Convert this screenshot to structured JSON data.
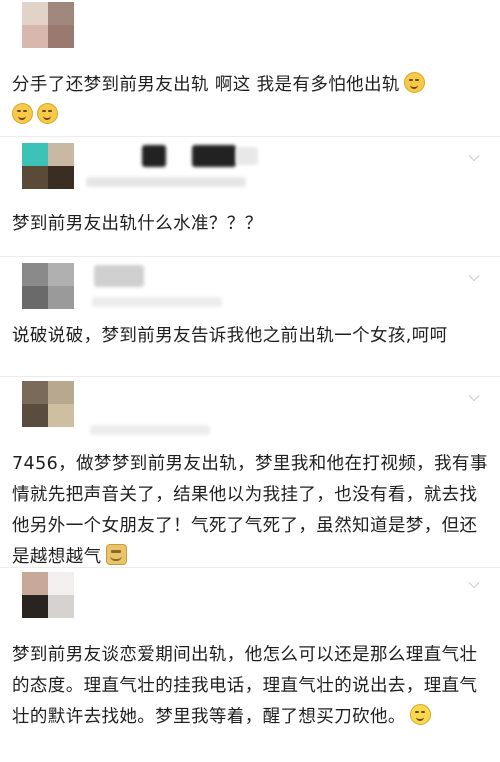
{
  "comments": [
    {
      "text": "分手了还梦到前男友出轨 啊这 我是有多怕他出轨",
      "emoji_names": [
        "facepalm-emoji",
        "facepalm-emoji",
        "facepalm-emoji"
      ],
      "avatar_colors": [
        "#e2d3c9",
        "#a0877d",
        "#d8b8ae",
        "#9a7a70"
      ]
    },
    {
      "text": "梦到前男友出轨什么水准？？？",
      "avatar_colors": [
        "#3cc2b6",
        "#c9b8a3",
        "#5a4a38",
        "#3a2e22"
      ]
    },
    {
      "text": "说破说破，梦到前男友告诉我他之前出轨一个女孩,呵呵",
      "avatar_colors": [
        "#8a8a8a",
        "#b0b0b0",
        "#6a6a6a",
        "#9a9a9a"
      ]
    },
    {
      "text": "7456，做梦梦到前男友出轨，梦里我和他在打视频，我有事情就先把声音关了，结果他以为我挂了，也没有看，就去找他另外一个女朋友了！气死了气死了，虽然知道是梦，但还是越想越气",
      "emoji_names": [
        "fist-emoji"
      ],
      "avatar_colors": [
        "#7a6a5a",
        "#b8a88f",
        "#5a4d40",
        "#cdbf9f"
      ]
    },
    {
      "text": "梦到前男友谈恋爱期间出轨，他怎么可以还是那么理直气壮的态度。理直气壮的挂我电话，理直气壮的说出去，理直气壮的默许去找她。梦里我等着，醒了想买刀砍他。",
      "emoji_names": [
        "smile-emoji"
      ],
      "avatar_colors": [
        "#c8a89a",
        "#f2efee",
        "#2a2420",
        "#d6d2d0"
      ]
    }
  ]
}
